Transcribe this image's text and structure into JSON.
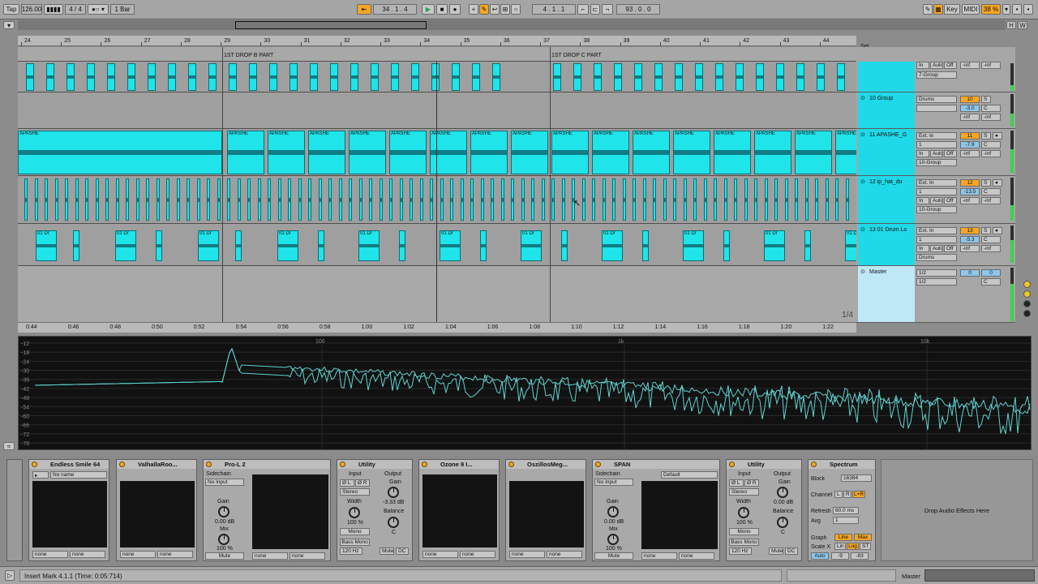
{
  "topbar": {
    "tap": "Tap",
    "tempo": "126.00",
    "time_sig": "4 / 4",
    "quantize": "1 Bar",
    "position": "34 .   1 .   4",
    "loop_start": "4 .   1 .   1",
    "loop_length": "93 .   0 .   0",
    "key_label": "Key",
    "midi_label": "MIDI",
    "cpu": "38 %"
  },
  "overview": {
    "h_label": "H",
    "w_label": "W"
  },
  "ruler": {
    "bars": [
      "24",
      "25",
      "26",
      "27",
      "28",
      "29",
      "30",
      "31",
      "32",
      "33",
      "34",
      "35",
      "36",
      "37",
      "38",
      "39",
      "40",
      "41",
      "42",
      "43",
      "44"
    ],
    "set_label": "Set"
  },
  "locators": [
    "1ST DROP B PART",
    "1ST DROP C PART"
  ],
  "time_ruler": {
    "times": [
      "0:44",
      "0:46",
      "0:48",
      "0:50",
      "0:52",
      "0:54",
      "0:56",
      "0:58",
      "1:00",
      "1:02",
      "1:04",
      "1:06",
      "1:08",
      "1:10",
      "1:12",
      "1:14",
      "1:16",
      "1:18",
      "1:20",
      "1:22"
    ],
    "grid": "1/4"
  },
  "clip_labels": {
    "apashe": "APASHE",
    "drum": "01 Dr"
  },
  "tracks": [
    {
      "name": "",
      "input": "",
      "io": [
        "In",
        "Auto",
        "Off"
      ],
      "out": "7-Group",
      "vol": "-inf",
      "pan": "-inf",
      "num": ""
    },
    {
      "name": "10 Group",
      "input": "Drums",
      "vol": "10",
      "vol2": "-3.0",
      "pan": "C",
      "send": "-inf",
      "send2": "-inf",
      "num": "S"
    },
    {
      "name": "11 APASHE_G",
      "input": "Ext. In",
      "ch": "1",
      "io": [
        "In",
        "Auto",
        "Off"
      ],
      "out": "10-Group",
      "vol": "11",
      "vol2": "-7.9",
      "pan": "C",
      "send": "-inf",
      "send2": "-inf",
      "num": "S"
    },
    {
      "name": "12 ip_hat_du",
      "input": "Ext. In",
      "ch": "1",
      "io": [
        "In",
        "Auto",
        "Off"
      ],
      "out": "10-Group",
      "vol": "12",
      "vol2": "-13.5",
      "pan": "C",
      "send": "-inf",
      "send2": "-inf",
      "num": "S"
    },
    {
      "name": "13 01 Drum Lo",
      "input": "Ext. In",
      "ch": "1",
      "io": [
        "In",
        "Auto",
        "Off"
      ],
      "out": "Drums",
      "vol": "13",
      "vol2": "-5.3",
      "pan": "C",
      "send": "-inf",
      "send2": "-inf",
      "num": "S"
    },
    {
      "name": "Master",
      "input": "1/2",
      "ch": "1/2",
      "vol": "0",
      "vol2": "0",
      "pan": "C"
    }
  ],
  "spectrum": {
    "db_labels": [
      "-12",
      "-18",
      "-24",
      "-30",
      "-36",
      "-42",
      "-48",
      "-54",
      "-60",
      "-66",
      "-72",
      "-78"
    ],
    "freq_labels": [
      "100",
      "1k",
      "10k"
    ]
  },
  "devices": {
    "d1": {
      "title": "Endless Smile 64",
      "preset": "No name",
      "sel1": "none",
      "sel2": "none"
    },
    "d2": {
      "title": "ValhallaRoo...",
      "sel1": "none",
      "sel2": "none"
    },
    "d3": {
      "title": "Pro-L 2",
      "sidechain": "Sidechain",
      "input": "No Input",
      "gain": "Gain",
      "gain_val": "0.00 dB",
      "mix": "Mix",
      "mix_val": "100 %",
      "mute": "Mute",
      "sel1": "none",
      "sel2": "none"
    },
    "d4": {
      "title": "Utility",
      "input": "Input",
      "output": "Output",
      "phase_l": "Ø L",
      "phase_r": "Ø R",
      "stereo": "Stereo",
      "width": "Width",
      "width_val": "100 %",
      "mono": "Mono",
      "bass_mono": "Bass Mono",
      "bass_freq": "120 Hz",
      "gain": "Gain",
      "gain_val": "-3.33 dB",
      "balance": "Balance",
      "balance_val": "C",
      "mute": "Mute",
      "dc": "DC"
    },
    "d5": {
      "title": "Ozone 9 I...",
      "sel1": "none",
      "sel2": "none"
    },
    "d6": {
      "title": "OszillosMeg...",
      "sel1": "none",
      "sel2": "none"
    },
    "d7": {
      "title": "SPAN",
      "sidechain": "Sidechain",
      "input": "No Input",
      "gain": "Gain",
      "gain_val": "0.00 dB",
      "mix": "Mix",
      "mix_val": "100 %",
      "mute": "Mute",
      "preset": "Default",
      "sel1": "none",
      "sel2": "none"
    },
    "d8": {
      "title": "Utility",
      "input": "Input",
      "output": "Output",
      "phase_l": "Ø L",
      "phase_r": "Ø R",
      "stereo": "Stereo",
      "width": "Width",
      "width_val": "100 %",
      "mono": "Mono",
      "bass_mono": "Bass Mono",
      "bass_freq": "120 Hz",
      "gain": "Gain",
      "gain_val": "0.00 dB",
      "balance": "Balance",
      "balance_val": "C",
      "mute": "Mute",
      "dc": "DC"
    },
    "d9": {
      "title": "Spectrum",
      "block": "Block",
      "block_val": "16384",
      "channel": "Channel",
      "ch_l": "L",
      "ch_r": "R",
      "ch_lr": "L+R",
      "refresh": "Refresh",
      "refresh_val": "60.0 ms",
      "avg": "Avg",
      "avg_val": "1",
      "graph": "Graph",
      "graph_line": "Line",
      "graph_max": "Max",
      "scale_x": "Scale X",
      "lin": "Lin",
      "log": "Log",
      "st": "ST",
      "auto": "Auto",
      "range_lo": "-9",
      "range_hi": "-83"
    },
    "drop_hint": "Drop Audio Effects Here"
  },
  "status": {
    "message": "Insert Mark 4.1.1 (Time: 0:05:714)",
    "master": "Master"
  },
  "colors": {
    "clip": "#1fe4ea",
    "accent": "#f5a623",
    "spectrum": "#5fd3d0"
  }
}
